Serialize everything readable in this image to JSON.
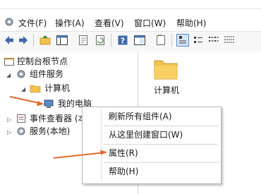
{
  "menu": {
    "items": [
      {
        "label": "文件(F)"
      },
      {
        "label": "操作(A)"
      },
      {
        "label": "查看(V)"
      },
      {
        "label": "窗口(W)"
      },
      {
        "label": "帮助(H)"
      }
    ]
  },
  "toolbar": {
    "buttons": [
      "back-arrow-icon",
      "forward-arrow-icon",
      "up-folder-icon",
      "console-tree-icon",
      "properties-icon",
      "refresh-icon",
      "help-icon",
      "show-hide-icon",
      "new-window-icon",
      "large-icons-view-icon",
      "small-icons-view-icon",
      "list-view-icon",
      "details-view-icon"
    ]
  },
  "tree": {
    "root": "控制台根节点",
    "component_services": "组件服务",
    "computers": "计算机",
    "my_computer": "我的电脑",
    "event_viewer": "事件查看器 (本",
    "services": "服务(本地)"
  },
  "list": {
    "items": [
      {
        "label": "计算机"
      }
    ]
  },
  "context_menu": {
    "items": [
      {
        "label": "刷新所有组件(A)"
      },
      {
        "label": "从这里创建窗口(W)"
      },
      {
        "label": "属性(R)"
      },
      {
        "label": "帮助(H)"
      }
    ]
  },
  "colors": {
    "annotation_arrow": "#e06a2c",
    "folder": "#f3c24e",
    "selection": "#cce8ff"
  }
}
